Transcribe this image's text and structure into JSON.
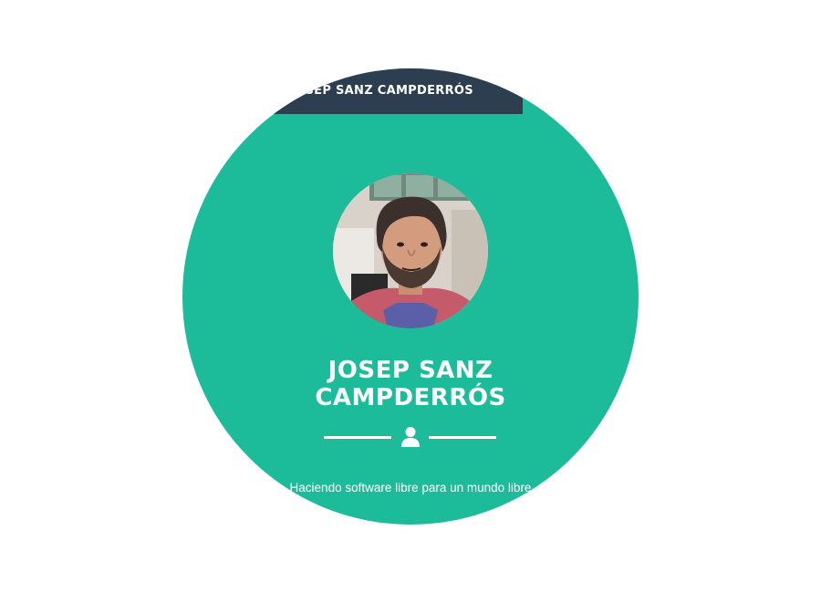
{
  "navbar": {
    "brand": "JOSEP SANZ CAMPDERRÓS"
  },
  "hero": {
    "name_line1": "JOSEP SANZ",
    "name_line2": "CAMPDERRÓS",
    "divider_icon": "user-icon",
    "tagline": "Haciendo software libre para un mundo libre"
  },
  "colors": {
    "primary": "#1cbc9b",
    "navbar": "#2c3e50",
    "text": "#ffffff"
  }
}
